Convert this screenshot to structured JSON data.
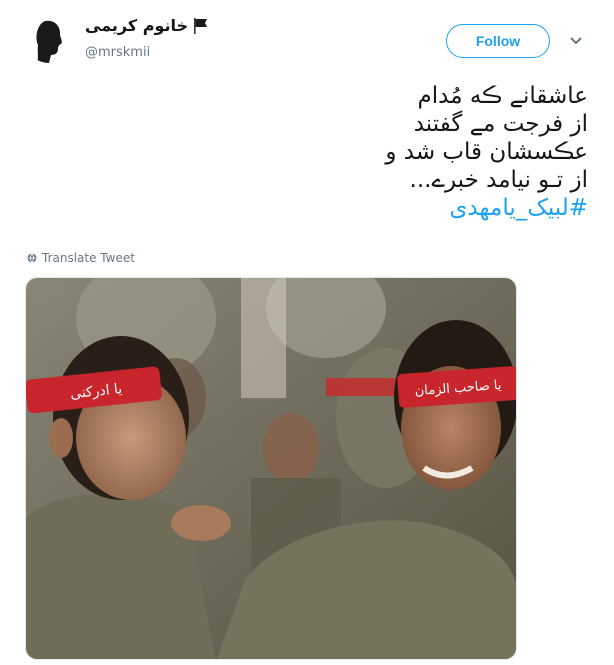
{
  "user": {
    "display_name": "خانوم کریمی",
    "handle": "@mrskmii"
  },
  "follow": {
    "label": "Follow"
  },
  "tweet": {
    "lines": [
      "عاشقانے ڪه مُدام",
      "از فرجت مے گفتند",
      "عڪسشان قاب شد و",
      "از تـو نیامد خبرے..."
    ],
    "hashtag": "#لبیک_یامهدی"
  },
  "translate": {
    "label": "Translate Tweet"
  },
  "media": {
    "headband_left_text": "یا ادرکنی",
    "headband_right_text": "یا صاحب الزمان"
  },
  "colors": {
    "accent": "#1da1f2",
    "headband": "#c8262c"
  },
  "icons": {
    "flag": "black-flag-icon",
    "menu": "chevron-down-icon",
    "translate": "globe-icon"
  }
}
